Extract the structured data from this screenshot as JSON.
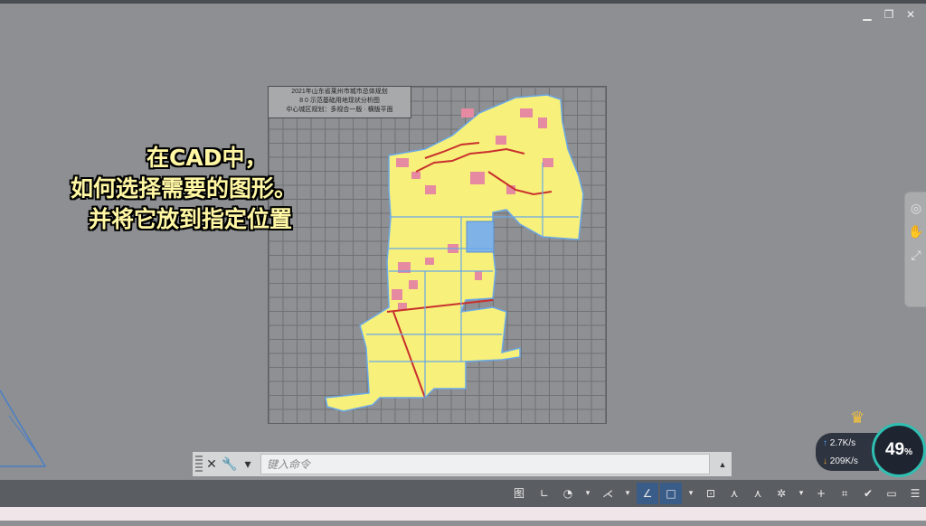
{
  "window_controls": {
    "minimize": "▁",
    "restore": "❐",
    "close": "✕"
  },
  "title_block": {
    "line1": "2021年山东省莱州市城市总体规划",
    "line2": "8 0 示范基础用地现状分析图",
    "line3": "中心城区规划：多规合一版 · 横版平面"
  },
  "overlay": {
    "line1": "在CAD中，",
    "line2": "如何选择需要的图形。",
    "line3": "并将它放到指定位置"
  },
  "command_line": {
    "placeholder": "键入命令",
    "close_glyph": "✕",
    "wrench_glyph": "🔧",
    "dropdown_glyph": "▾",
    "scroll_glyph": "▲"
  },
  "status_bar": {
    "model_label": "图纸",
    "icons": [
      "grid-icon",
      "ortho-icon",
      "polar-icon",
      "osnap-icon",
      "otrack-icon",
      "lineweight-icon",
      "selection-icon",
      "annotation-icon",
      "workspace-icon",
      "settings-icon",
      "plus-icon",
      "units-icon",
      "isolate-icon",
      "fullscreen-icon",
      "menu-icon"
    ]
  },
  "network": {
    "upload": "2.7K/s",
    "download": "209K/s",
    "up_arrow": "↑",
    "down_arrow": "↓"
  },
  "gauge": {
    "value": "49",
    "unit": "%"
  },
  "colors": {
    "map_fill": "#f7f07a",
    "map_road": "#6aa8e8",
    "map_pink": "#e58aa0",
    "map_red": "#c8302e",
    "water": "#7fb3e8"
  }
}
